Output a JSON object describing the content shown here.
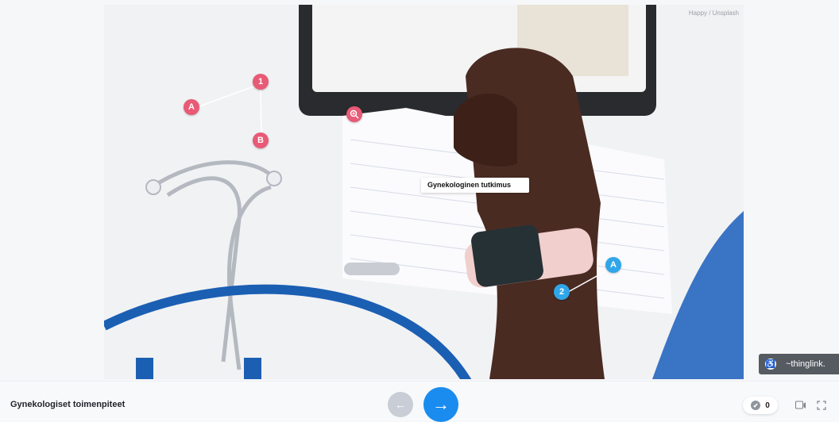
{
  "image": {
    "credit": "Happy / Unsplash"
  },
  "hotspots": [
    {
      "label": "1",
      "color": "#e85a76"
    },
    {
      "label": "A",
      "color": "#e85a76"
    },
    {
      "label": "B",
      "color": "#e85a76"
    },
    {
      "label": "A",
      "color": "#2fa6ea"
    },
    {
      "label": "2",
      "color": "#2fa6ea"
    }
  ],
  "zoom_icon": "zoom-in-icon",
  "tooltip": {
    "text": "Gynekologinen tutkimus"
  },
  "branding": {
    "logo_text": "~thinglink.",
    "accessibility_icon": "accessibility-icon"
  },
  "footer": {
    "title": "Gynekologiset toimenpiteet",
    "prev_icon": "arrow-left-icon",
    "next_icon": "arrow-right-icon",
    "reactions_count": "0",
    "accent_color": "#1a8cf0"
  }
}
